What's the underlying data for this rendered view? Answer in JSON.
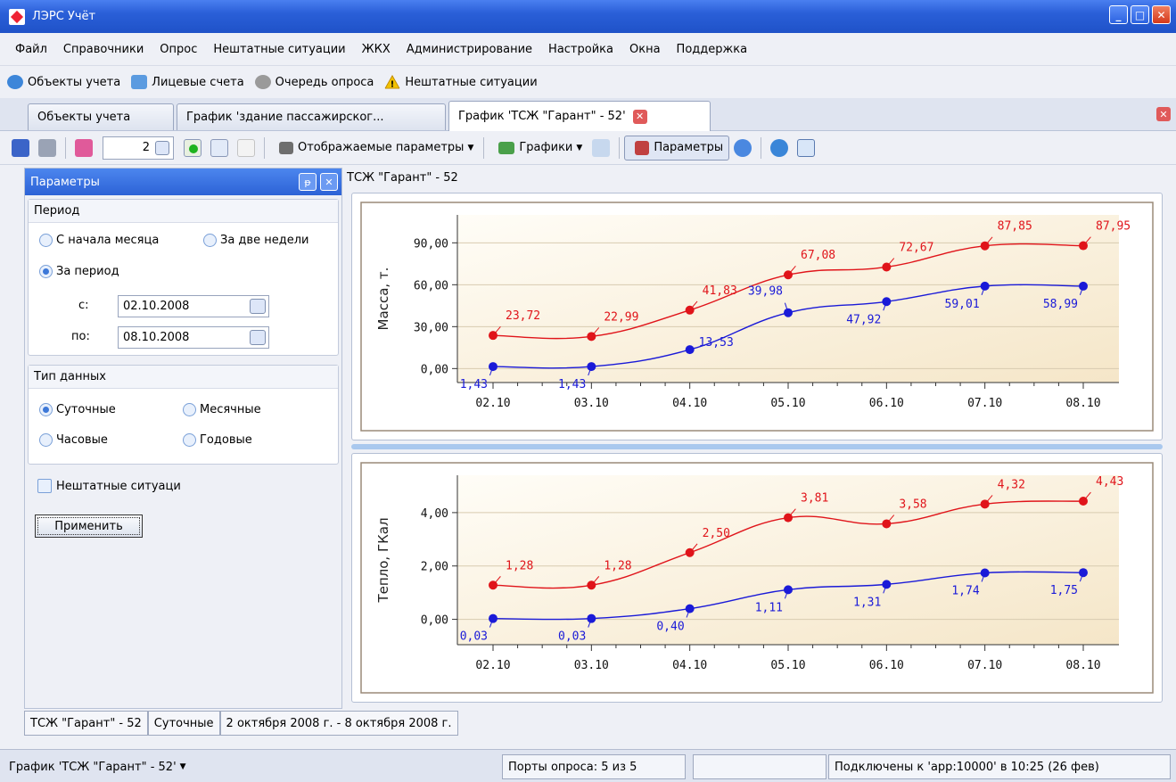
{
  "window": {
    "title": "ЛЭРС Учёт"
  },
  "menu": [
    "Файл",
    "Справочники",
    "Опрос",
    "Нештатные ситуации",
    "ЖКХ",
    "Администрирование",
    "Настройка",
    "Окна",
    "Поддержка"
  ],
  "quickbar": [
    {
      "label": "Объекты учета",
      "icon": "buildings-icon",
      "color": "#3d86d9"
    },
    {
      "label": "Лицевые счета",
      "icon": "accounts-icon",
      "color": "#5b9be0"
    },
    {
      "label": "Очередь опроса",
      "icon": "queue-icon",
      "color": "#8f8f8f"
    },
    {
      "label": "Нештатные ситуации",
      "icon": "warning-icon",
      "color": "#f2c200"
    }
  ],
  "tabs": {
    "t1": "Объекты учета",
    "t2": "График 'здание пассажирског...",
    "t3": "График 'ТСЖ \"Гарант\" - 52'"
  },
  "toolbar": {
    "spin_value": "2",
    "display_params": "Отображаемые параметры",
    "graphs": "Графики",
    "params": "Параметры"
  },
  "panel": {
    "title": "Параметры",
    "period_group": "Период",
    "opt_month_start": "С начала месяца",
    "opt_two_weeks": "За две недели",
    "opt_period": "За период",
    "from_label": "с:",
    "to_label": "по:",
    "date_from": "02.10.2008",
    "date_to": "08.10.2008",
    "type_group": "Тип данных",
    "opt_daily": "Суточные",
    "opt_monthly": "Месячные",
    "opt_hourly": "Часовые",
    "opt_yearly": "Годовые",
    "incidents": "Нештатные ситуаци",
    "apply": "Применить"
  },
  "chart_header": "ТСЖ \"Гарант\" - 52",
  "chart_data": [
    {
      "type": "line",
      "ylabel": "Масса, т.",
      "x": [
        "02.10",
        "03.10",
        "04.10",
        "05.10",
        "06.10",
        "07.10",
        "08.10"
      ],
      "yticks": [
        "0,00",
        "30,00",
        "60,00",
        "90,00"
      ],
      "ylim": [
        -10,
        110
      ],
      "series": [
        {
          "color": "#e0141a",
          "values": [
            23.72,
            22.99,
            41.83,
            67.08,
            72.67,
            87.85,
            87.95
          ],
          "labels": [
            "23,72",
            "22,99",
            "41,83",
            "67,08",
            "72,67",
            "87,85",
            "87,95"
          ]
        },
        {
          "color": "#1a1ad8",
          "values": [
            1.43,
            1.43,
            13.53,
            39.98,
            47.92,
            59.01,
            58.99
          ],
          "labels": [
            "1,43",
            "1,43",
            "13,53",
            "39,98",
            "47,92",
            "59,01",
            "58,99"
          ]
        }
      ]
    },
    {
      "type": "line",
      "ylabel": "Тепло, ГКал",
      "x": [
        "02.10",
        "03.10",
        "04.10",
        "05.10",
        "06.10",
        "07.10",
        "08.10"
      ],
      "yticks": [
        "0,00",
        "2,00",
        "4,00"
      ],
      "ylim": [
        -0.95,
        5.4
      ],
      "series": [
        {
          "color": "#e0141a",
          "values": [
            1.28,
            1.28,
            2.5,
            3.81,
            3.58,
            4.32,
            4.43
          ],
          "labels": [
            "1,28",
            "1,28",
            "2,50",
            "3,81",
            "3,58",
            "4,32",
            "4,43"
          ]
        },
        {
          "color": "#1a1ad8",
          "values": [
            0.03,
            0.03,
            0.4,
            1.11,
            1.31,
            1.74,
            1.75
          ],
          "labels": [
            "0,03",
            "0,03",
            "0,40",
            "1,11",
            "1,31",
            "1,74",
            "1,75"
          ]
        }
      ]
    }
  ],
  "info": {
    "object": "ТСЖ \"Гарант\" - 52",
    "type": "Суточные",
    "range": "2 октября 2008 г. - 8 октября 2008 г."
  },
  "status": {
    "current": "График 'ТСЖ \"Гарант\" - 52'",
    "ports": "Порты опроса: 5 из 5",
    "connection": "Подключены к 'app:10000' в 10:25 (26 фев)"
  }
}
